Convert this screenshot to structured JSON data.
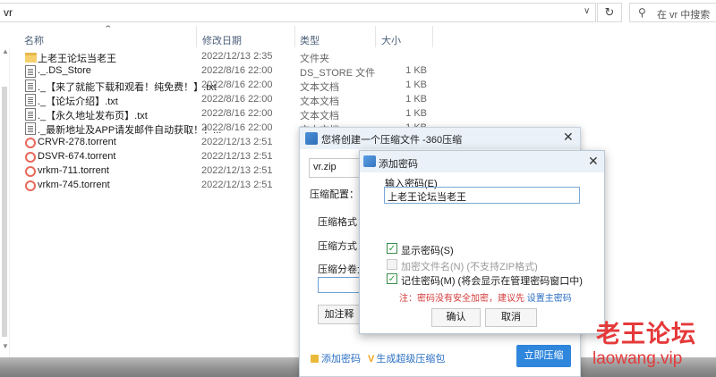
{
  "explorer": {
    "address": "vr",
    "refresh_icon": "refresh-icon",
    "search_placeholder": "在 vr 中搜索",
    "columns": {
      "name": "名称",
      "date": "修改日期",
      "type": "类型",
      "size": "大小"
    },
    "files": [
      {
        "name": "上老王论坛当老王",
        "date": "2022/12/13 2:35",
        "type": "文件夹",
        "size": "",
        "icon": "folder-icon"
      },
      {
        "name": "._.DS_Store",
        "date": "2022/8/16 22:00",
        "type": "DS_STORE 文件",
        "size": "1 KB",
        "icon": "file-icon"
      },
      {
        "name": "._【来了就能下载和观看！纯免费！】.txt",
        "date": "2022/8/16 22:00",
        "type": "文本文档",
        "size": "1 KB",
        "icon": "text-file-icon"
      },
      {
        "name": "._【论坛介绍】.txt",
        "date": "2022/8/16 22:00",
        "type": "文本文档",
        "size": "1 KB",
        "icon": "text-file-icon"
      },
      {
        "name": "._【永久地址发布页】.txt",
        "date": "2022/8/16 22:00",
        "type": "文本文档",
        "size": "1 KB",
        "icon": "text-file-icon"
      },
      {
        "name": "._最新地址及APP请发邮件自动获取！！...",
        "date": "2022/8/16 22:00",
        "type": "文本文档",
        "size": "1 KB",
        "icon": "text-file-icon"
      },
      {
        "name": "CRVR-278.torrent",
        "date": "2022/12/13 2:51",
        "type": "",
        "size": "",
        "icon": "torrent-icon"
      },
      {
        "name": "DSVR-674.torrent",
        "date": "2022/12/13 2:51",
        "type": "",
        "size": "",
        "icon": "torrent-icon"
      },
      {
        "name": "vrkm-711.torrent",
        "date": "2022/12/13 2:51",
        "type": "",
        "size": "",
        "icon": "torrent-icon"
      },
      {
        "name": "vrkm-745.torrent",
        "date": "2022/12/13 2:51",
        "type": "",
        "size": "",
        "icon": "torrent-icon"
      }
    ]
  },
  "compress_dialog": {
    "title": "您将创建一个压缩文件 -360压缩",
    "archive_name": "vr.zip",
    "config_label": "压缩配置：",
    "format_label": "压缩格式：",
    "method_label": "压缩方式：",
    "volume_label": "压缩分卷大小",
    "annotate_button": "加注释",
    "add_password_link": "添加密码",
    "super_compress_link": "生成超级压缩包",
    "compress_button": "立即压缩"
  },
  "password_dialog": {
    "title": "添加密码",
    "input_label": "输入密码(E)",
    "password_value": "上老王论坛当老王",
    "show_password": {
      "label": "显示密码(S)",
      "checked": true
    },
    "encrypt_names": {
      "label": "加密文件名(N) (不支持ZIP格式)",
      "checked": false,
      "disabled": true
    },
    "remember_password": {
      "label": "记住密码(M) (将会显示在管理密码窗口中)",
      "checked": true
    },
    "warning": "注：密码没有安全加密，建议先",
    "master_password_link": "设置主密码",
    "ok_button": "确认",
    "cancel_button": "取消"
  },
  "watermark": {
    "title": "老王论坛",
    "url": "laowang.vip"
  },
  "colors": {
    "accent": "#2f86dd",
    "watermark": "#e5393a",
    "warning": "#d43a3a",
    "check": "#2d9a3e"
  }
}
